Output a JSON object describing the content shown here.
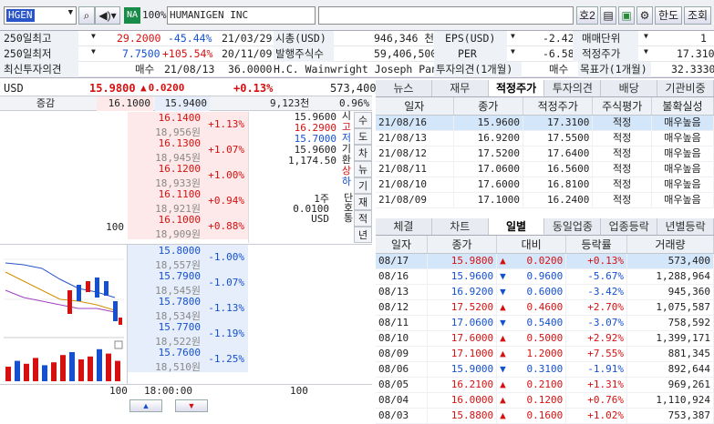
{
  "toolbar": {
    "code": "HGEN",
    "market": "NA",
    "pct": "100%",
    "name": "HUMANIGEN INC",
    "ho": "호2",
    "hanto": "한도",
    "jo": "조회"
  },
  "info": {
    "rows": [
      [
        "250일최고",
        "29.2000",
        "-45.44%",
        "21/03/29",
        "시총(USD)",
        "946,346 천",
        "EPS(USD)",
        "-2.42",
        "매매단위",
        "1"
      ],
      [
        "250일최저",
        "7.7500",
        "+105.54%",
        "20/11/09",
        "발행주식수",
        "59,406,500",
        "PER",
        "-6.58",
        "적정주가",
        "17.310"
      ],
      [
        "최신투자의견",
        "매수",
        "21/08/13",
        "36.0000",
        "H.C. Wainwright Joseph Pantgi",
        "",
        "투자의견(1개월)",
        "매수",
        "목표가(1개월)",
        "32.3330"
      ]
    ]
  },
  "quote": {
    "cur": "USD",
    "price": "15.9800",
    "chg": "0.0200",
    "pct": "+0.13%",
    "vol": "573,400",
    "inc": "증감",
    "bid": "16.1000",
    "ask": "15.9400",
    "tvol": "9,123천",
    "ratio": "0.96%"
  },
  "book": {
    "asks": [
      [
        "16.1400",
        "18,956원",
        "+1.13%"
      ],
      [
        "16.1300",
        "18,945원",
        "+1.07%"
      ],
      [
        "16.1200",
        "18,933원",
        "+1.00%"
      ],
      [
        "16.1100",
        "18,921원",
        "+0.94%"
      ],
      [
        "16.1000",
        "18,909원",
        "+0.88%"
      ]
    ],
    "ask_qty": [
      "",
      "",
      "",
      "",
      "100"
    ],
    "bids": [
      [
        "15.8000",
        "18,557원",
        "-1.00%"
      ],
      [
        "15.7900",
        "18,545원",
        "-1.07%"
      ],
      [
        "15.7800",
        "18,534원",
        "-1.13%"
      ],
      [
        "15.7700",
        "18,522원",
        "-1.19%"
      ],
      [
        "15.7600",
        "18,510원",
        "-1.25%"
      ]
    ],
    "bid_qty": [
      "100",
      "",
      "",
      "",
      ""
    ],
    "side": [
      "시",
      "고",
      "저",
      "기",
      "환",
      "상",
      "하"
    ],
    "sidevals": [
      "15.9600",
      "16.2900",
      "15.7000",
      "15.9600",
      "1,174.50",
      "",
      ""
    ],
    "sidevtabs": [
      "수",
      "도",
      "차",
      "뉴",
      "기",
      "재",
      "적",
      "년"
    ],
    "unit": [
      "1주",
      "0.0100",
      "USD"
    ],
    "unitlbl": [
      "단",
      "호",
      "통"
    ],
    "foot_left": "100",
    "foot_time": "18:00:00",
    "foot_right": "100"
  },
  "rtabs1": [
    "뉴스",
    "재무",
    "적정주가",
    "투자의견",
    "배당",
    "기관비중"
  ],
  "fair": {
    "headers": [
      "일자",
      "종가",
      "적정주가",
      "주식평가",
      "불확실성"
    ],
    "rows": [
      [
        "21/08/16",
        "15.9600",
        "17.3100",
        "적정",
        "매우높음"
      ],
      [
        "21/08/13",
        "16.9200",
        "17.5500",
        "적정",
        "매우높음"
      ],
      [
        "21/08/12",
        "17.5200",
        "17.6400",
        "적정",
        "매우높음"
      ],
      [
        "21/08/11",
        "17.0600",
        "16.5600",
        "적정",
        "매우높음"
      ],
      [
        "21/08/10",
        "17.6000",
        "16.8100",
        "적정",
        "매우높음"
      ],
      [
        "21/08/09",
        "17.1000",
        "16.2400",
        "적정",
        "매우높음"
      ]
    ]
  },
  "rtabs2": [
    "체결",
    "차트",
    "일별",
    "동일업종",
    "업종등락",
    "년별등락"
  ],
  "daily": {
    "headers": [
      "일자",
      "종가",
      "대비",
      "등락률",
      "거래량"
    ],
    "rows": [
      [
        "08/17",
        "15.9800",
        "u",
        "0.0200",
        "+0.13%",
        "573,400"
      ],
      [
        "08/16",
        "15.9600",
        "d",
        "0.9600",
        "-5.67%",
        "1,288,964"
      ],
      [
        "08/13",
        "16.9200",
        "d",
        "0.6000",
        "-3.42%",
        "945,360"
      ],
      [
        "08/12",
        "17.5200",
        "u",
        "0.4600",
        "+2.70%",
        "1,075,587"
      ],
      [
        "08/11",
        "17.0600",
        "d",
        "0.5400",
        "-3.07%",
        "758,592"
      ],
      [
        "08/10",
        "17.6000",
        "u",
        "0.5000",
        "+2.92%",
        "1,399,171"
      ],
      [
        "08/09",
        "17.1000",
        "u",
        "1.2000",
        "+7.55%",
        "881,345"
      ],
      [
        "08/06",
        "15.9000",
        "d",
        "0.3100",
        "-1.91%",
        "892,644"
      ],
      [
        "08/05",
        "16.2100",
        "u",
        "0.2100",
        "+1.31%",
        "969,261"
      ],
      [
        "08/04",
        "16.0000",
        "u",
        "0.1200",
        "+0.76%",
        "1,110,924"
      ],
      [
        "08/03",
        "15.8800",
        "u",
        "0.1600",
        "+1.02%",
        "753,387"
      ]
    ]
  },
  "colors": {
    "up": "#d61010",
    "down": "#1450d0",
    "accent": "#1a3a8c"
  }
}
